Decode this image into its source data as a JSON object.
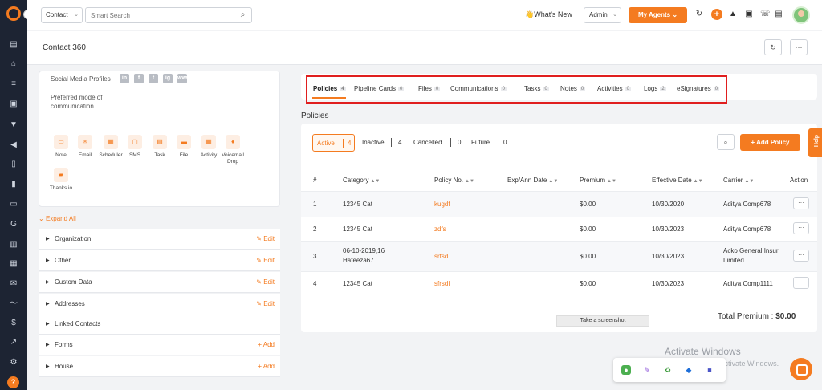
{
  "colors": {
    "accent": "#f47b20",
    "sidebar": "#1d2433",
    "highlight_border": "#e01e1e"
  },
  "topbar": {
    "search_type": "Contact",
    "search_placeholder": "Smart Search",
    "whats_new": "👋What's New",
    "admin": "Admin",
    "my_agents": "My Agents"
  },
  "page": {
    "title": "Contact 360"
  },
  "left": {
    "social_label": "Social Media Profiles",
    "social_icons": [
      "in",
      "f",
      "t",
      "ig",
      "www"
    ],
    "pref_label": "Preferred mode of communication",
    "actions": [
      "Note",
      "Email",
      "Scheduler",
      "SMS",
      "Task",
      "File",
      "Activity",
      "Voicemail Drop",
      "Thanks.io"
    ],
    "expand_all": "Expand All",
    "sections": [
      {
        "title": "Organization",
        "action": "Edit"
      },
      {
        "title": "Other",
        "action": "Edit"
      },
      {
        "title": "Custom Data",
        "action": "Edit"
      },
      {
        "title": "Addresses",
        "action": "Edit"
      },
      {
        "title": "Linked Contacts",
        "action": ""
      },
      {
        "title": "Forms",
        "action": "Add"
      },
      {
        "title": "House",
        "action": "Add"
      }
    ]
  },
  "tabs": [
    {
      "label": "Policies",
      "count": "4"
    },
    {
      "label": "Pipeline Cards",
      "count": "0"
    },
    {
      "label": "Files",
      "count": "0"
    },
    {
      "label": "Communications",
      "count": "0"
    },
    {
      "label": "Tasks",
      "count": "0"
    },
    {
      "label": "Notes",
      "count": "0"
    },
    {
      "label": "Activities",
      "count": "0"
    },
    {
      "label": "Logs",
      "count": "2"
    },
    {
      "label": "eSignatures",
      "count": "0"
    }
  ],
  "policies": {
    "title": "Policies",
    "filters": [
      {
        "label": "Active",
        "count": "4"
      },
      {
        "label": "Inactive",
        "count": "4"
      },
      {
        "label": "Cancelled",
        "count": "0"
      },
      {
        "label": "Future",
        "count": "0"
      }
    ],
    "add_label": "Add Policy",
    "columns": [
      "#",
      "Category",
      "Policy No.",
      "Exp/Ann Date",
      "Premium",
      "Effective Date",
      "Carrier",
      "Action"
    ],
    "rows": [
      {
        "num": "1",
        "category": "12345 Cat",
        "policy_no": "kugdf",
        "exp": "",
        "premium": "$0.00",
        "effective": "10/30/2020",
        "carrier": "Aditya Comp678"
      },
      {
        "num": "2",
        "category": "12345 Cat",
        "policy_no": "zdfs",
        "exp": "",
        "premium": "$0.00",
        "effective": "10/30/2023",
        "carrier": "Aditya Comp678"
      },
      {
        "num": "3",
        "category": "06-10-2019,16",
        "category2": "Hafeeza67",
        "policy_no": "srfsd",
        "exp": "",
        "premium": "$0.00",
        "effective": "10/30/2023",
        "carrier": "Acko General Insur",
        "carrier2": "Limited"
      },
      {
        "num": "4",
        "category": "12345 Cat",
        "policy_no": "sfrsdf",
        "exp": "",
        "premium": "$0.00",
        "effective": "10/30/2023",
        "carrier": "Aditya Comp1111"
      }
    ],
    "total_label": "Total Premium : ",
    "total_value": "$0.00"
  },
  "screenshot_btn": "Take a screenshot",
  "help_label": "Help",
  "watermark": {
    "line1": "Activate Windows",
    "line2": "Go to Settings to activate Windows."
  }
}
